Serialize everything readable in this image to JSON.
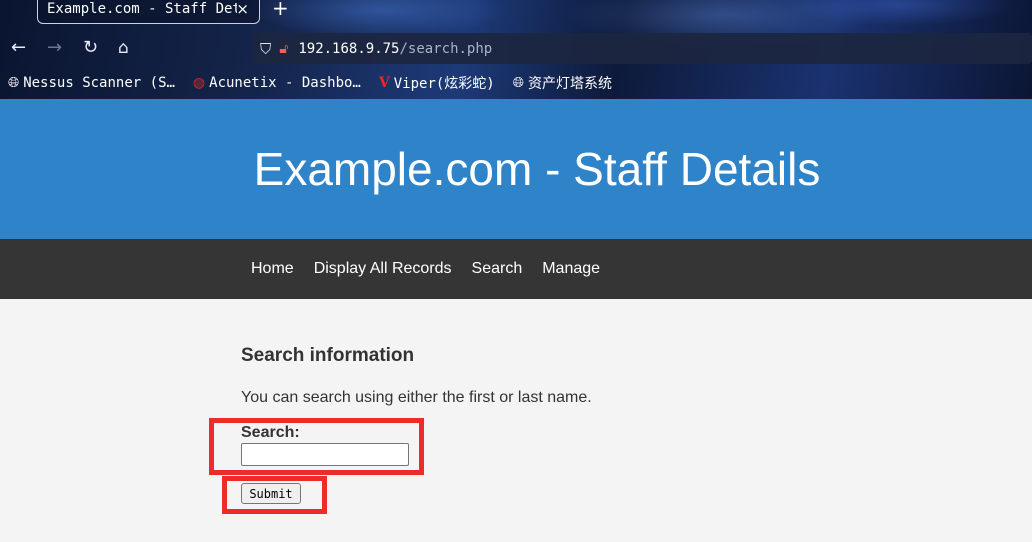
{
  "browser": {
    "tab_title": "Example.com - Staff Details",
    "tab_close": "×",
    "new_tab": "+",
    "url_host": "192.168.9.75",
    "url_path": "/search.php",
    "bookmarks": [
      {
        "label": "Nessus Scanner (S…",
        "icon": "globe-icon"
      },
      {
        "label": "Acunetix - Dashbo…",
        "icon": "acunetix-icon"
      },
      {
        "label": "Viper(炫彩蛇)",
        "icon": "viper-icon"
      },
      {
        "label": "资产灯塔系统",
        "icon": "globe-icon"
      }
    ]
  },
  "header": {
    "title": "Example.com - Staff Details",
    "bg_color": "#2e83c9"
  },
  "nav": {
    "items": [
      {
        "label": "Home"
      },
      {
        "label": "Display All Records"
      },
      {
        "label": "Search"
      },
      {
        "label": "Manage"
      }
    ]
  },
  "main": {
    "heading": "Search information",
    "description": "You can search using either the first or last name.",
    "search_label": "Search:",
    "search_value": "",
    "submit_label": "Submit"
  },
  "annotations": {
    "highlight_color": "#ee2b2b"
  }
}
